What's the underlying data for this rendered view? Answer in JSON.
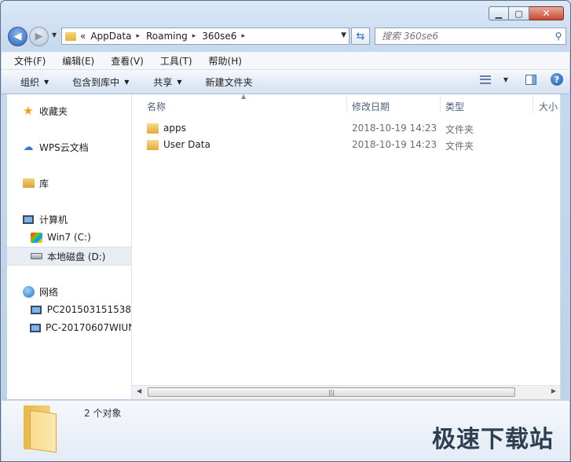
{
  "window": {
    "min_glyph": "▁",
    "max_glyph": "▢",
    "close_glyph": "✕"
  },
  "nav": {
    "path_prefix": "«",
    "path": [
      "AppData",
      "Roaming",
      "360se6"
    ],
    "path_sep": "▸",
    "search_placeholder": "搜索 360se6"
  },
  "menu": [
    "文件(F)",
    "编辑(E)",
    "查看(V)",
    "工具(T)",
    "帮助(H)"
  ],
  "commands": {
    "organize": "组织",
    "include_in_library": "包含到库中",
    "share": "共享",
    "new_folder": "新建文件夹"
  },
  "sidebar": {
    "favorites": "收藏夹",
    "wps_cloud": "WPS云文档",
    "library": "库",
    "computer": "计算机",
    "drive_c": "Win7 (C:)",
    "drive_d": "本地磁盘 (D:)",
    "network": "网络",
    "pc1": "PC201503151538",
    "pc2": "PC-20170607WIUN"
  },
  "columns": {
    "name": "名称",
    "date": "修改日期",
    "type": "类型",
    "size": "大小"
  },
  "files": [
    {
      "name": "apps",
      "date": "2018-10-19 14:23",
      "type": "文件夹"
    },
    {
      "name": "User Data",
      "date": "2018-10-19 14:23",
      "type": "文件夹"
    }
  ],
  "details": {
    "count": "2 个对象"
  },
  "watermark": "极速下载站"
}
